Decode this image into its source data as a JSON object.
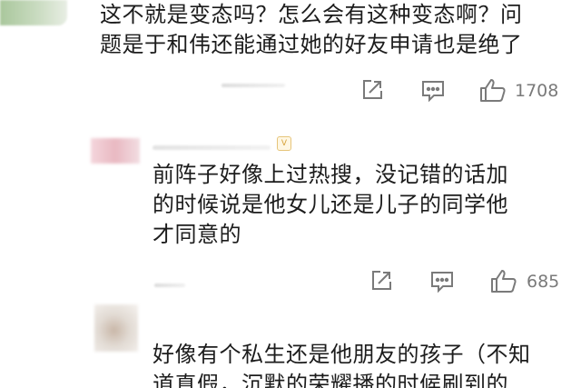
{
  "comments": [
    {
      "lines": [
        "这不就是变态吗？怎么会有这种变态啊？问",
        "题是于和伟还能通过她的好友申请也是绝了"
      ],
      "actions": {
        "share": "share-icon",
        "reply": "comment-icon",
        "like": "like-icon",
        "like_count": "1708"
      }
    },
    {
      "lines": [
        "前阵子好像上过热搜，没记错的话加",
        "的时候说是他女儿还是儿子的同学他",
        "才同意的"
      ],
      "actions": {
        "share": "share-icon",
        "reply": "comment-icon",
        "like": "like-icon",
        "like_count": "685"
      }
    },
    {
      "lines": [
        "好像有个私生还是他朋友的孩子（不知",
        "道真假，沉默的荣耀播的时候刷到的"
      ]
    }
  ],
  "colors": {
    "text": "#1c1c1c",
    "icon": "#7a7a7a",
    "count": "#7a7a7a"
  }
}
